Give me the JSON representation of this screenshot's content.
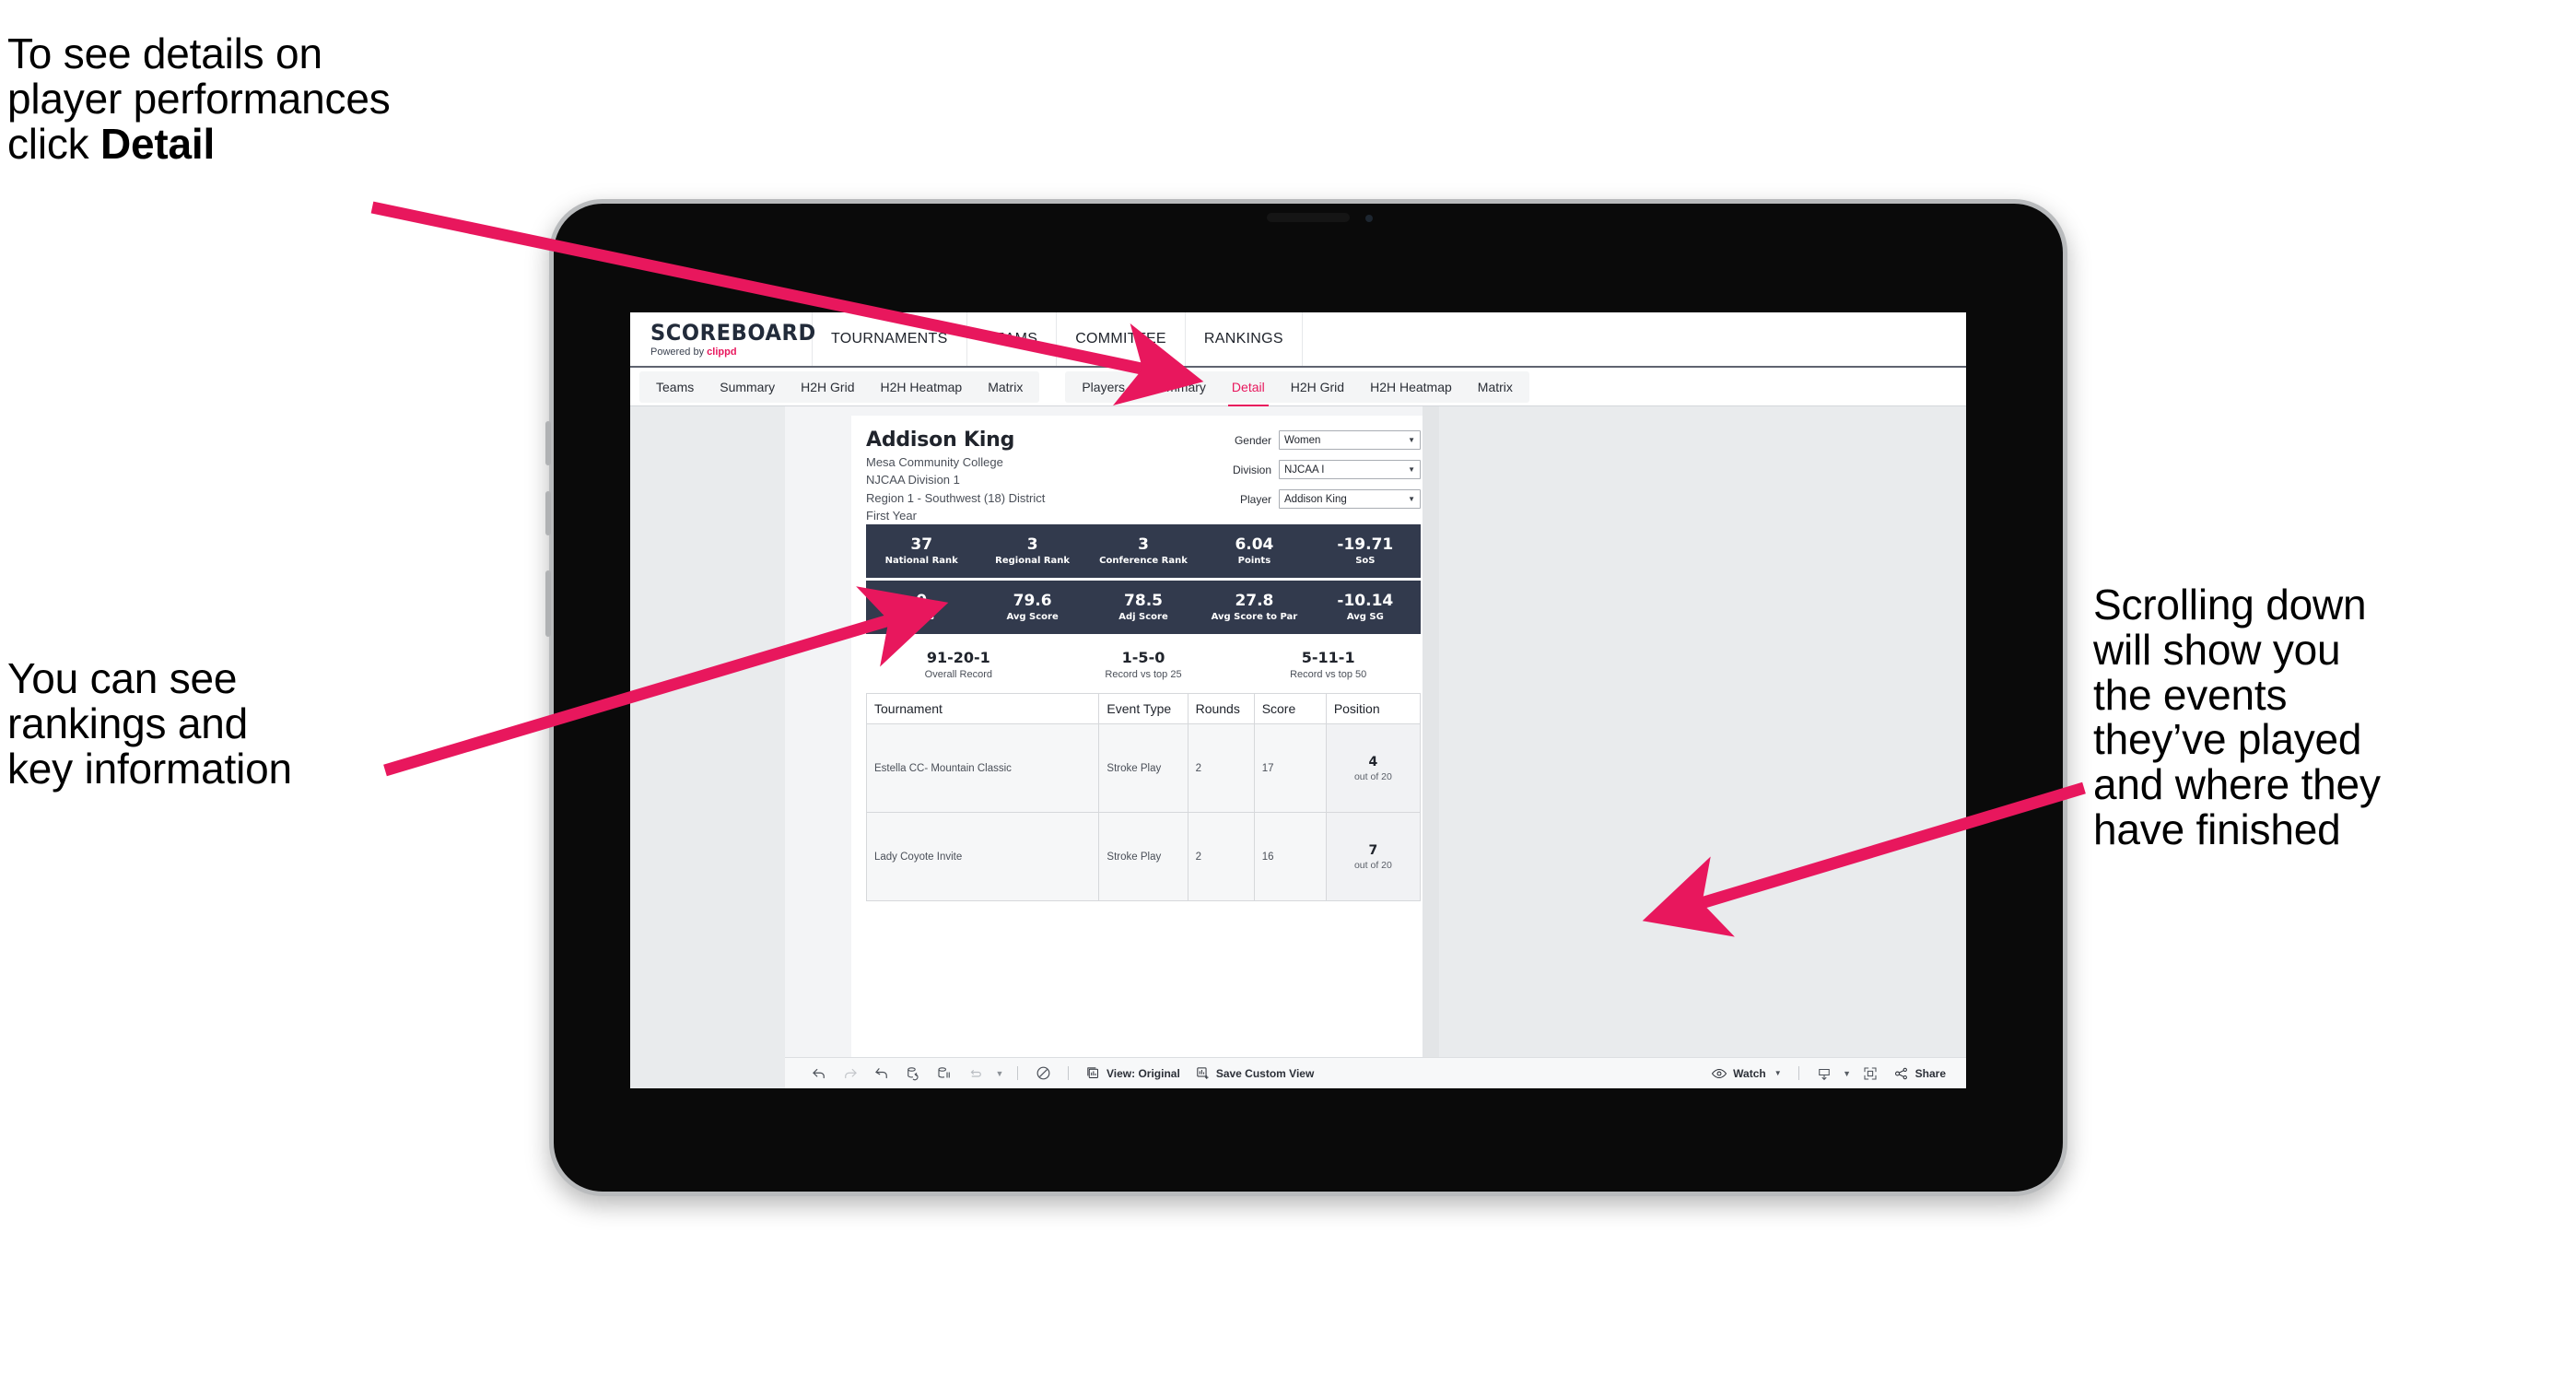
{
  "annotations": {
    "top_left": {
      "line1": "To see details on",
      "line2": "player performances",
      "line3_prefix": "click ",
      "line3_bold": "Detail"
    },
    "mid_left": {
      "line1": "You can see",
      "line2": "rankings and",
      "line3": "key information"
    },
    "right": {
      "line1": "Scrolling down",
      "line2": "will show you",
      "line3": "the events",
      "line4": "they’ve played",
      "line5": "and where they",
      "line6": "have finished"
    },
    "arrow_color": "#e8175d"
  },
  "app": {
    "brand": {
      "title": "SCOREBOARD",
      "powered_prefix": "Powered by ",
      "powered_name": "clippd"
    },
    "topnav": [
      {
        "label": "TOURNAMENTS"
      },
      {
        "label": "TEAMS"
      },
      {
        "label": "COMMITTEE"
      },
      {
        "label": "RANKINGS"
      }
    ],
    "subnav": {
      "teams_group": [
        {
          "label": "Teams",
          "active": false
        },
        {
          "label": "Summary",
          "active": false
        },
        {
          "label": "H2H Grid",
          "active": false
        },
        {
          "label": "H2H Heatmap",
          "active": false
        },
        {
          "label": "Matrix",
          "active": false
        }
      ],
      "players_group": [
        {
          "label": "Players",
          "active": false
        },
        {
          "label": "Summary",
          "active": false
        },
        {
          "label": "Detail",
          "active": true
        },
        {
          "label": "H2H Grid",
          "active": false
        },
        {
          "label": "H2H Heatmap",
          "active": false
        },
        {
          "label": "Matrix",
          "active": false
        }
      ],
      "active_color": "#e8175d"
    }
  },
  "player": {
    "name": "Addison King",
    "school": "Mesa Community College",
    "division": "NJCAA Division 1",
    "region": "Region 1 - Southwest (18) District",
    "year": "First Year"
  },
  "filters": [
    {
      "label": "Gender",
      "value": "Women"
    },
    {
      "label": "Division",
      "value": "NJCAA I"
    },
    {
      "label": "Player",
      "value": "Addison King"
    }
  ],
  "stats_row_1": [
    {
      "value": "37",
      "label": "National Rank"
    },
    {
      "value": "3",
      "label": "Regional Rank"
    },
    {
      "value": "3",
      "label": "Conference Rank"
    },
    {
      "value": "6.04",
      "label": "Points"
    },
    {
      "value": "-19.71",
      "label": "SoS"
    }
  ],
  "stats_row_2": [
    {
      "value": "0",
      "label": "Wins"
    },
    {
      "value": "79.6",
      "label": "Avg Score"
    },
    {
      "value": "78.5",
      "label": "Adj Score"
    },
    {
      "value": "27.8",
      "label": "Avg Score to Par"
    },
    {
      "value": "-10.14",
      "label": "Avg SG"
    }
  ],
  "records": [
    {
      "value": "91-20-1",
      "label": "Overall Record"
    },
    {
      "value": "1-5-0",
      "label": "Record vs top 25"
    },
    {
      "value": "5-11-1",
      "label": "Record vs top 50"
    }
  ],
  "table": {
    "headers": [
      "Tournament",
      "Event Type",
      "Rounds",
      "Score",
      "Position"
    ],
    "rows": [
      {
        "tournament": "Estella CC- Mountain Classic",
        "event_type": "Stroke Play",
        "rounds": "2",
        "score": "17",
        "position_num": "4",
        "position_sub": "out of 20"
      },
      {
        "tournament": "Lady Coyote Invite",
        "event_type": "Stroke Play",
        "rounds": "2",
        "score": "16",
        "position_num": "7",
        "position_sub": "out of 20"
      }
    ]
  },
  "toolbar": {
    "view_label": "View: Original",
    "save_label": "Save Custom View",
    "watch_label": "Watch",
    "share_label": "Share"
  },
  "stat_bar_color": "#323a4d"
}
